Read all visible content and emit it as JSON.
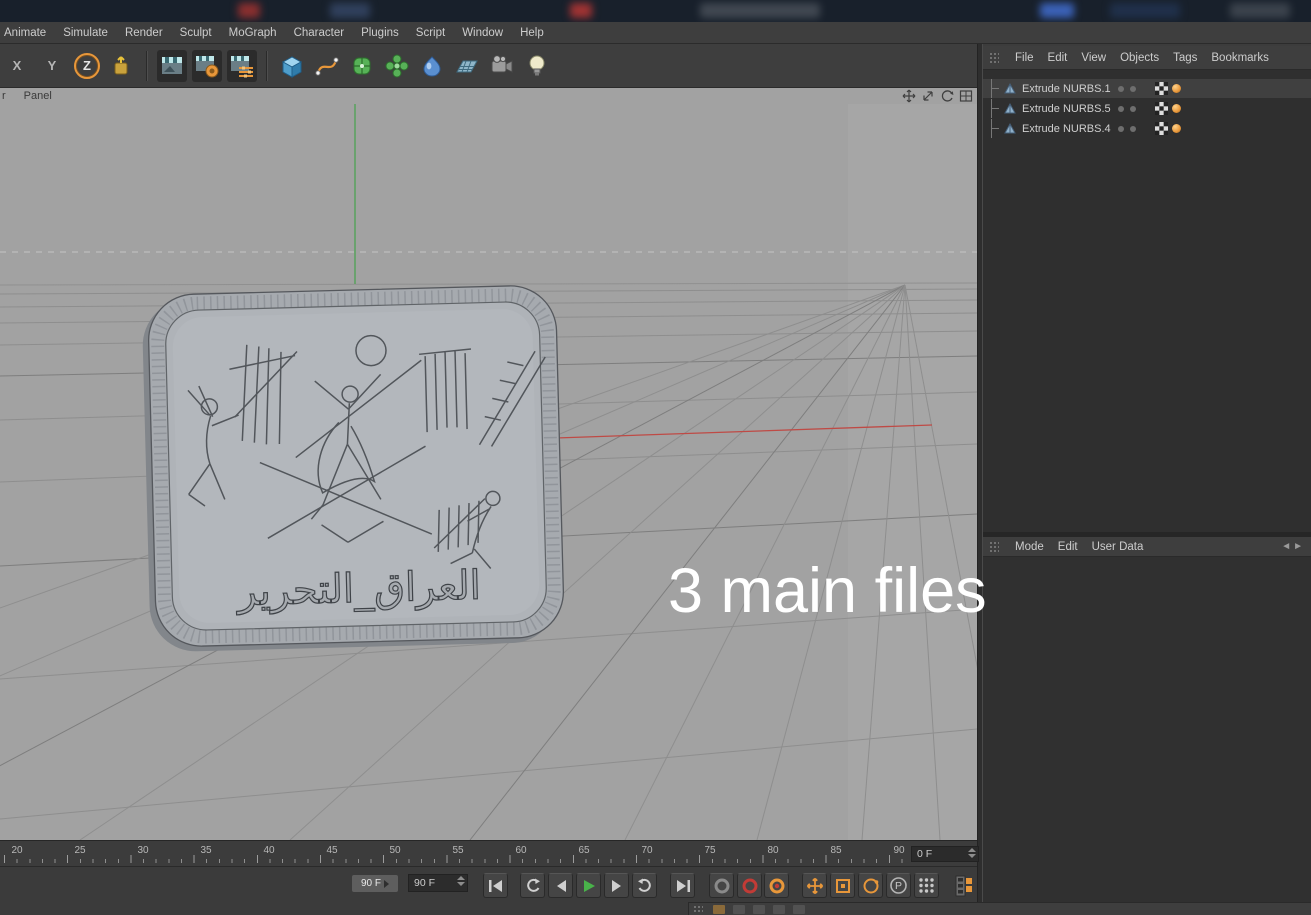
{
  "menubar": {
    "items": [
      "Animate",
      "Simulate",
      "Render",
      "Sculpt",
      "MoGraph",
      "Character",
      "Plugins",
      "Script",
      "Window",
      "Help"
    ]
  },
  "toolbar": {
    "axis": {
      "x": "X",
      "y": "Y",
      "z": "Z"
    }
  },
  "viewport": {
    "menu_truncated": "r",
    "menu_panel": "Panel"
  },
  "object_manager": {
    "menu": [
      "File",
      "Edit",
      "View",
      "Objects",
      "Tags",
      "Bookmarks"
    ],
    "objects": [
      {
        "name": "Extrude NURBS.1"
      },
      {
        "name": "Extrude NURBS.5"
      },
      {
        "name": "Extrude NURBS.4"
      }
    ]
  },
  "attribute_manager": {
    "menu": [
      "Mode",
      "Edit",
      "User Data"
    ]
  },
  "overlay": {
    "caption": "3 main files"
  },
  "plaque": {
    "inscription": "العراق_التحرير"
  },
  "timeline": {
    "ticks": [
      "20",
      "25",
      "30",
      "35",
      "40",
      "45",
      "50",
      "55",
      "60",
      "65",
      "70",
      "75",
      "80",
      "85",
      "90"
    ],
    "end_frame": "0 F"
  },
  "transport": {
    "slider_value": "90 F",
    "frame_field": "90 F",
    "p_label": "P"
  },
  "icons": {
    "play": "green-right-triangle",
    "record": "red-circle",
    "move-tool": "orange-cross-arrows",
    "scale-tool": "orange-square",
    "rotate-tool": "orange-ring",
    "grip": "dot-grid"
  },
  "colors": {
    "accent": "#e8973a",
    "play_green": "#49b24a",
    "axis_red": "#bf4a45",
    "axis_green": "#4da352"
  }
}
